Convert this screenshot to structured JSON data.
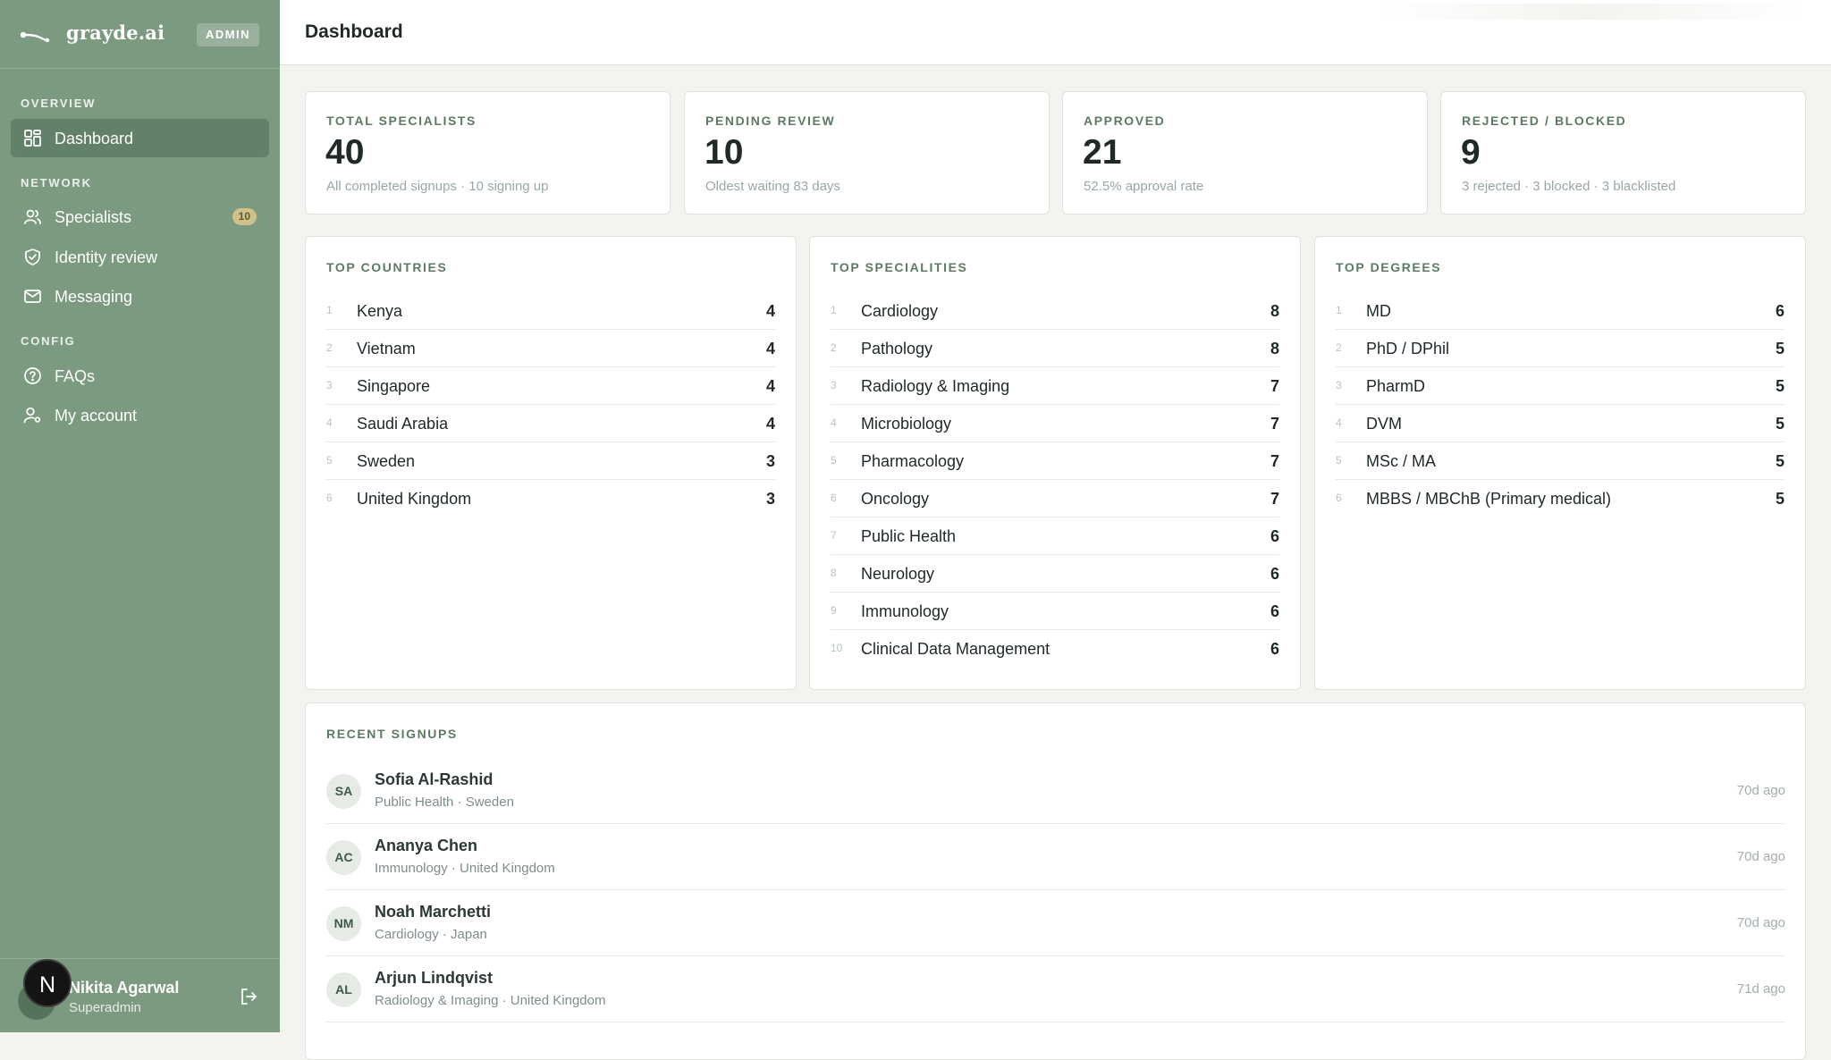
{
  "brand": {
    "name": "grayde.ai",
    "badge": "ADMIN"
  },
  "sidebar": {
    "sections": [
      "OVERVIEW",
      "NETWORK",
      "CONFIG"
    ],
    "items": [
      {
        "label": "Dashboard",
        "icon": "grid-icon"
      },
      {
        "label": "Specialists",
        "icon": "users-icon",
        "count": "10"
      },
      {
        "label": "Identity review",
        "icon": "shield-check-icon"
      },
      {
        "label": "Messaging",
        "icon": "mail-icon"
      },
      {
        "label": "FAQs",
        "icon": "help-circle-icon"
      },
      {
        "label": "My account",
        "icon": "user-cog-icon"
      }
    ],
    "user": {
      "initial": "N",
      "name": "Nikita Agarwal",
      "role": "Superadmin"
    }
  },
  "header": {
    "title": "Dashboard"
  },
  "stats": [
    {
      "label": "TOTAL SPECIALISTS",
      "value": "40",
      "sub": "All completed signups · 10 signing up"
    },
    {
      "label": "PENDING REVIEW",
      "value": "10",
      "sub": "Oldest waiting 83 days"
    },
    {
      "label": "APPROVED",
      "value": "21",
      "sub": "52.5% approval rate"
    },
    {
      "label": "REJECTED / BLOCKED",
      "value": "9",
      "sub": "3 rejected · 3 blocked · 3 blacklisted"
    }
  ],
  "top_countries": {
    "title": "TOP COUNTRIES",
    "rows": [
      {
        "rank": "1",
        "label": "Kenya",
        "count": "4"
      },
      {
        "rank": "2",
        "label": "Vietnam",
        "count": "4"
      },
      {
        "rank": "3",
        "label": "Singapore",
        "count": "4"
      },
      {
        "rank": "4",
        "label": "Saudi Arabia",
        "count": "4"
      },
      {
        "rank": "5",
        "label": "Sweden",
        "count": "3"
      },
      {
        "rank": "6",
        "label": "United Kingdom",
        "count": "3"
      }
    ]
  },
  "top_specialities": {
    "title": "TOP SPECIALITIES",
    "rows": [
      {
        "rank": "1",
        "label": "Cardiology",
        "count": "8"
      },
      {
        "rank": "2",
        "label": "Pathology",
        "count": "8"
      },
      {
        "rank": "3",
        "label": "Radiology & Imaging",
        "count": "7"
      },
      {
        "rank": "4",
        "label": "Microbiology",
        "count": "7"
      },
      {
        "rank": "5",
        "label": "Pharmacology",
        "count": "7"
      },
      {
        "rank": "6",
        "label": "Oncology",
        "count": "7"
      },
      {
        "rank": "7",
        "label": "Public Health",
        "count": "6"
      },
      {
        "rank": "8",
        "label": "Neurology",
        "count": "6"
      },
      {
        "rank": "9",
        "label": "Immunology",
        "count": "6"
      },
      {
        "rank": "10",
        "label": "Clinical Data Management",
        "count": "6"
      }
    ]
  },
  "top_degrees": {
    "title": "TOP DEGREES",
    "rows": [
      {
        "rank": "1",
        "label": "MD",
        "count": "6"
      },
      {
        "rank": "2",
        "label": "PhD / DPhil",
        "count": "5"
      },
      {
        "rank": "3",
        "label": "PharmD",
        "count": "5"
      },
      {
        "rank": "4",
        "label": "DVM",
        "count": "5"
      },
      {
        "rank": "5",
        "label": "MSc / MA",
        "count": "5"
      },
      {
        "rank": "6",
        "label": "MBBS / MBChB (Primary medical)",
        "count": "5"
      }
    ]
  },
  "recent_signups": {
    "title": "RECENT SIGNUPS",
    "rows": [
      {
        "initials": "SA",
        "name": "Sofia Al-Rashid",
        "meta": "Public Health · Sweden",
        "time": "70d ago"
      },
      {
        "initials": "AC",
        "name": "Ananya Chen",
        "meta": "Immunology · United Kingdom",
        "time": "70d ago"
      },
      {
        "initials": "NM",
        "name": "Noah Marchetti",
        "meta": "Cardiology · Japan",
        "time": "70d ago"
      },
      {
        "initials": "AL",
        "name": "Arjun Lindqvist",
        "meta": "Radiology & Imaging · United Kingdom",
        "time": "71d ago"
      }
    ]
  },
  "colors": {
    "sidebar": "#7b9a80",
    "accent": "#5d7a63",
    "badge": "#d7c78c"
  }
}
